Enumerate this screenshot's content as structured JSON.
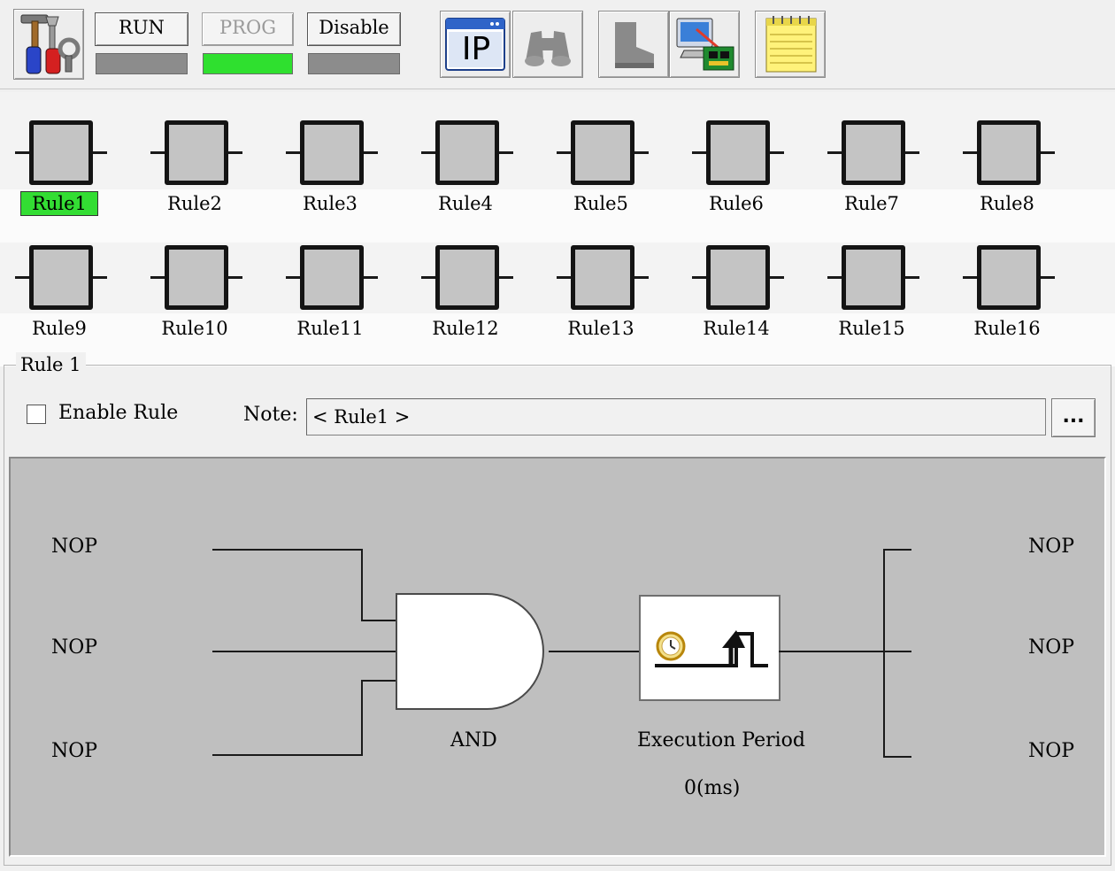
{
  "toolbar": {
    "tools_icon": "tools-icon",
    "modes": [
      {
        "label": "RUN",
        "state": "normal",
        "indicator_color": "#8c8c8c"
      },
      {
        "label": "PROG",
        "state": "disabled",
        "indicator_color": "#2fe02f"
      },
      {
        "label": "Disable",
        "state": "normal",
        "indicator_color": "#8c8c8c"
      }
    ],
    "ip_label": "IP",
    "icons": [
      "ip-config-icon",
      "binoculars-icon",
      "boot-icon",
      "computer-board-icon",
      "notepad-icon"
    ]
  },
  "rules": {
    "row1": [
      "Rule1",
      "Rule2",
      "Rule3",
      "Rule4",
      "Rule5",
      "Rule6",
      "Rule7",
      "Rule8"
    ],
    "row2": [
      "Rule9",
      "Rule10",
      "Rule11",
      "Rule12",
      "Rule13",
      "Rule14",
      "Rule15",
      "Rule16"
    ],
    "active_rule": "Rule1",
    "active_color": "#33dd33"
  },
  "editor": {
    "group_title": "Rule 1",
    "enable_label": "Enable Rule",
    "enable_checked": false,
    "note_label": "Note:",
    "note_value": "< Rule1 >",
    "ellipsis_label": "..."
  },
  "diagram": {
    "inputs": [
      "NOP",
      "NOP",
      "NOP"
    ],
    "gate_label": "AND",
    "exec_label": "Execution Period",
    "exec_value": "0(ms)",
    "outputs": [
      "NOP",
      "NOP",
      "NOP"
    ],
    "background_color": "#bfbfbf"
  }
}
